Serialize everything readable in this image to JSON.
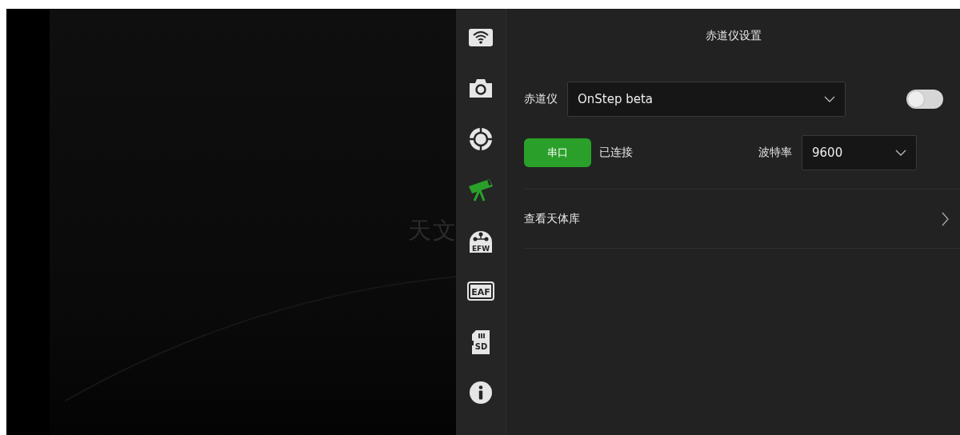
{
  "background": {
    "watermark_text": "天文"
  },
  "sidebar": {
    "items": [
      {
        "kind": "wifi",
        "selected": false
      },
      {
        "kind": "camera",
        "selected": false
      },
      {
        "kind": "guide",
        "selected": false
      },
      {
        "kind": "telescope",
        "selected": true
      },
      {
        "kind": "efw",
        "label": "EFW",
        "selected": false
      },
      {
        "kind": "eaf",
        "label": "EAF",
        "selected": false
      },
      {
        "kind": "sd",
        "label": "SD",
        "selected": false
      },
      {
        "kind": "info",
        "selected": false
      }
    ]
  },
  "panel": {
    "title": "赤道仪设置",
    "mount": {
      "label": "赤道仪",
      "value": "OnStep beta",
      "on": false
    },
    "connection": {
      "button": "串口",
      "status": "已连接",
      "baud_label": "波特率",
      "baud_value": "9600"
    },
    "links": [
      {
        "label": "查看天体库"
      }
    ]
  }
}
